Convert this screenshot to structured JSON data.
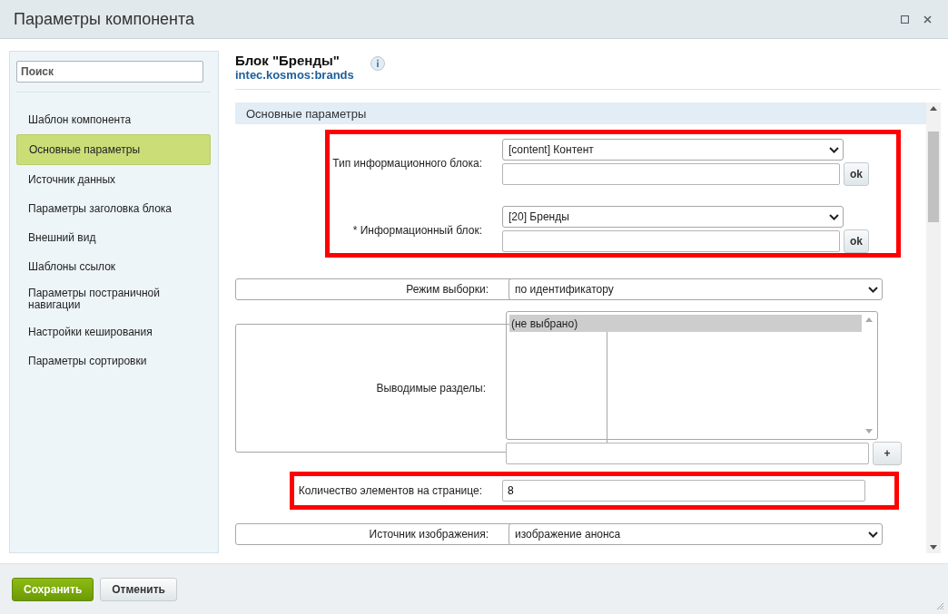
{
  "window": {
    "title": "Параметры компонента"
  },
  "sidebar": {
    "search": {
      "placeholder": "Поиск"
    },
    "items": [
      {
        "label": "Шаблон компонента",
        "selected": false
      },
      {
        "label": "Основные параметры",
        "selected": true
      },
      {
        "label": "Источник данных",
        "selected": false
      },
      {
        "label": "Параметры заголовка блока",
        "selected": false
      },
      {
        "label": "Внешний вид",
        "selected": false
      },
      {
        "label": "Шаблоны ссылок",
        "selected": false
      },
      {
        "label": "Параметры постраничной навигации",
        "selected": false
      },
      {
        "label": "Настройки кеширования",
        "selected": false
      },
      {
        "label": "Параметры сортировки",
        "selected": false
      }
    ]
  },
  "component": {
    "title": "Блок \"Бренды\"",
    "code": "intec.kosmos:brands"
  },
  "section": {
    "title": "Основные параметры"
  },
  "groups": [
    {
      "highlighted": true,
      "fields": [
        {
          "kind": "select_input",
          "label": "Тип информационного блока:",
          "value": "[content] Контент",
          "button": "ok"
        },
        {
          "kind": "select_input",
          "label": "* Информационный блок:",
          "value": "[20] Бренды",
          "button": "ok"
        }
      ]
    },
    {
      "highlighted": false,
      "fields": [
        {
          "kind": "select",
          "label": "Режим выборки:",
          "value": "по идентификатору"
        },
        {
          "kind": "listbox",
          "label": "Выводимые разделы:",
          "options": [
            {
              "label": "(не выбрано)",
              "selected": true
            }
          ],
          "button": "+"
        }
      ]
    },
    {
      "highlighted": true,
      "fields": [
        {
          "kind": "text",
          "label": "Количество элементов на странице:",
          "value": "8"
        }
      ]
    },
    {
      "highlighted": false,
      "fields": [
        {
          "kind": "select",
          "label": "Источник изображения:",
          "value": "изображение анонса"
        }
      ]
    }
  ],
  "footer": {
    "buttons": [
      {
        "label": "Сохранить",
        "kind": "primary"
      },
      {
        "label": "Отменить",
        "kind": "secondary"
      }
    ]
  }
}
